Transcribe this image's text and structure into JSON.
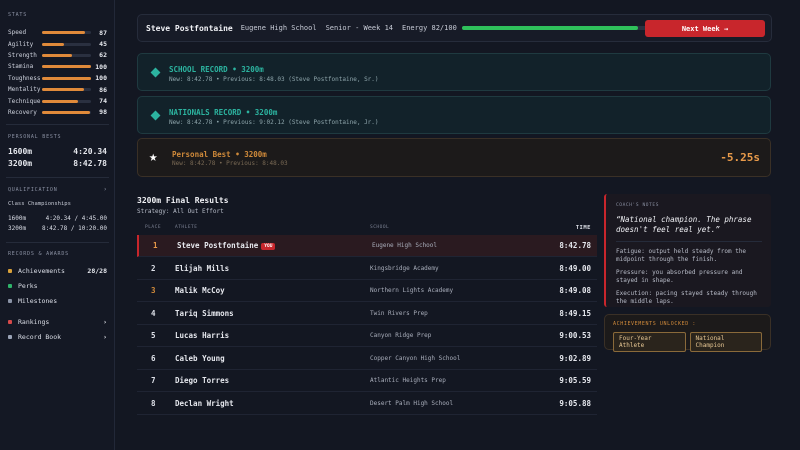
{
  "sidebar": {
    "stats_title": "STATS",
    "stats": [
      {
        "name": "Speed",
        "value": 87
      },
      {
        "name": "Agility",
        "value": 45
      },
      {
        "name": "Strength",
        "value": 62
      },
      {
        "name": "Stamina",
        "value": 100
      },
      {
        "name": "Toughness",
        "value": 100
      },
      {
        "name": "Mentality",
        "value": 86
      },
      {
        "name": "Technique",
        "value": 74
      },
      {
        "name": "Recovery",
        "value": 98
      }
    ],
    "pb_title": "PERSONAL BESTS",
    "personal_bests": [
      {
        "event": "1600m",
        "time": "4:20.34"
      },
      {
        "event": "3200m",
        "time": "8:42.78"
      }
    ],
    "qual_title": "QUALIFICATION",
    "qual_chevron": "›",
    "qual_sub": "Class Championships",
    "qualifications": [
      {
        "event": "1600m",
        "mark": "4:20.34 / 4:45.00"
      },
      {
        "event": "3200m",
        "mark": "8:42.78 / 10:20.00"
      }
    ],
    "records_title": "RECORDS & AWARDS",
    "nav": [
      {
        "label": "Achievements",
        "right": "28/28",
        "color": "#d9a13a"
      },
      {
        "label": "Perks",
        "right": "",
        "color": "#2fb46a"
      },
      {
        "label": "Milestones",
        "right": "",
        "color": "#8a93a6"
      },
      {
        "label": "Rankings",
        "right": "›",
        "color": "#d84a4a"
      },
      {
        "label": "Record Book",
        "right": "›",
        "color": "#9aa3b6"
      }
    ]
  },
  "topbar": {
    "name": "Steve Postfontaine",
    "school": "Eugene High School",
    "week": "Senior - Week 14",
    "energy_label": "Energy 82/100",
    "energy": 82,
    "next_button": "Next Week →"
  },
  "records": [
    {
      "title": "SCHOOL RECORD • 3200m",
      "sub": "New: 8:42.78 • Previous: 8:48.03 (Steve Postfontaine, Sr.)"
    },
    {
      "title": "NATIONALS RECORD • 3200m",
      "sub": "New: 8:42.78 • Previous: 9:02.12 (Steve Postfontaine, Jr.)"
    }
  ],
  "pb": {
    "title": "Personal Best • 3200m",
    "sub": "New: 8:42.78 • Previous: 8:48.03",
    "delta": "-5.25s"
  },
  "results": {
    "title": "3200m Final Results",
    "strategy": "Strategy: All Out Effort",
    "headers": {
      "place": "PLACE",
      "athlete": "ATHLETE",
      "school": "SCHOOL",
      "time": "TIME"
    },
    "you_badge": "YOU",
    "rows": [
      {
        "place": "1",
        "athlete": "Steve Postfontaine",
        "school": "Eugene High School",
        "time": "8:42.78",
        "you": true,
        "place_color": "#e89a4a"
      },
      {
        "place": "2",
        "athlete": "Elijah Mills",
        "school": "Kingsbridge Academy",
        "time": "8:49.00",
        "you": false,
        "place_color": "#dfe2ea"
      },
      {
        "place": "3",
        "athlete": "Malik McCoy",
        "school": "Northern Lights Academy",
        "time": "8:49.08",
        "you": false,
        "place_color": "#d08a3a"
      },
      {
        "place": "4",
        "athlete": "Tariq Simmons",
        "school": "Twin Rivers Prep",
        "time": "8:49.15",
        "you": false,
        "place_color": "#dfe2ea"
      },
      {
        "place": "5",
        "athlete": "Lucas Harris",
        "school": "Canyon Ridge Prep",
        "time": "9:00.53",
        "you": false,
        "place_color": "#dfe2ea"
      },
      {
        "place": "6",
        "athlete": "Caleb Young",
        "school": "Copper Canyon High School",
        "time": "9:02.89",
        "you": false,
        "place_color": "#dfe2ea"
      },
      {
        "place": "7",
        "athlete": "Diego Torres",
        "school": "Atlantic Heights Prep",
        "time": "9:05.59",
        "you": false,
        "place_color": "#dfe2ea"
      },
      {
        "place": "8",
        "athlete": "Declan Wright",
        "school": "Desert Palm High School",
        "time": "9:05.88",
        "you": false,
        "place_color": "#dfe2ea"
      }
    ]
  },
  "notes": {
    "title": "COACH'S NOTES",
    "quote": "“National champion. The phrase doesn't feel real yet.”",
    "lines": [
      "Fatigue: output held steady from the midpoint through the finish.",
      "Pressure: you absorbed pressure and stayed in shape.",
      "Execution: pacing stayed steady through the middle laps."
    ]
  },
  "achievements": {
    "title": "ACHIEVEMENTS UNLOCKED :",
    "badges": [
      "Four-Year Athlete",
      "National Champion"
    ]
  }
}
